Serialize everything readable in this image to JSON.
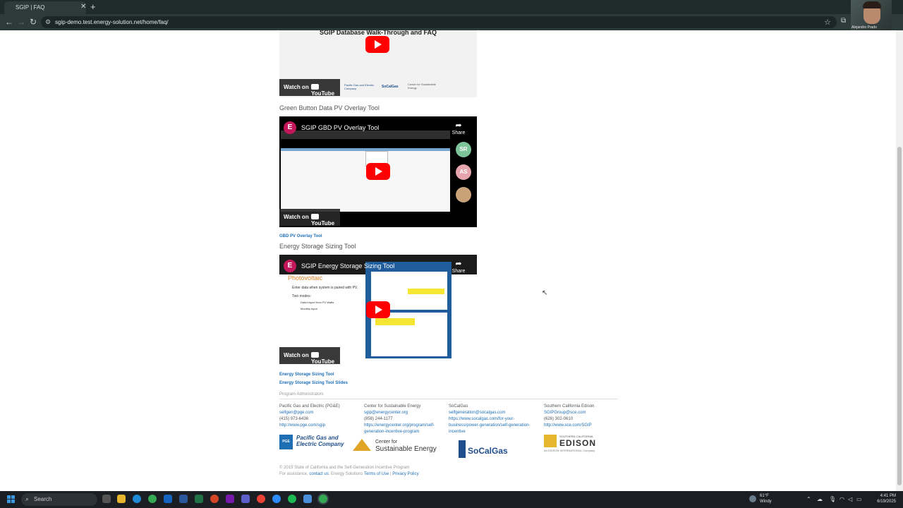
{
  "browser": {
    "tab_title": "SGIP | FAQ",
    "url": "sgip-demo.test.energy-solution.net/home/faq/",
    "webcam_label": "Alejandro Prado"
  },
  "videos": {
    "first": {
      "title": "SGIP Database Walk-Through and FAQ",
      "watch_on": "Watch on",
      "youtube": "YouTube",
      "sponsor_1": "Pacific Gas and Electric Company",
      "sponsor_2": "SoCalGas",
      "sponsor_3": "Center for Sustainable Energy"
    },
    "green_button": {
      "section_title": "Green Button Data PV Overlay Tool",
      "avatar": "E",
      "title": "SGIP GBD PV Overlay Tool",
      "share": "Share",
      "watch_on": "Watch on",
      "youtube": "YouTube",
      "participant_1": "SR",
      "participant_2": "AS",
      "link": "GBD PV Overlay Tool"
    },
    "storage": {
      "section_title": "Energy Storage Sizing Tool",
      "avatar": "E",
      "title": "SGIP Energy Storage Sizing Tool",
      "share": "Share",
      "watch_on": "Watch on",
      "youtube": "YouTube",
      "slide_heading": "Photovoltaic",
      "slide_bullet_1": "Enter data when system is paired with PV.",
      "slide_bullet_2": "Two modes:",
      "slide_sub_1": "Data import from PV Watts",
      "slide_sub_2": "Monthly input",
      "link_1": "Energy Storage Sizing Tool",
      "link_2": "Energy Storage Sizing Tool Slides"
    }
  },
  "admins": {
    "label": "Program Administrators",
    "pge": {
      "name": "Pacific Gas and Electric (PG&E)",
      "email": "selfgen@pge.com",
      "phone": "(415) 973-6436",
      "url": "http://www.pge.com/sgip"
    },
    "cse": {
      "name": "Center for Sustainable Energy",
      "email": "sgip@energycenter.org",
      "phone": "(858) 244-1177",
      "url_1": "https://energycenter.org/program/self-",
      "url_2": "generation-incentive-program"
    },
    "socal": {
      "name": "SoCalGas",
      "email": "selfgeneration@socalgas.com",
      "url_1": "https://www.socalgas.com/for-your-",
      "url_2": "business/power-generation/self-generation-",
      "url_3": "incentive"
    },
    "sce": {
      "name": "Southern California Edison",
      "email": "SGIPGroup@sce.com",
      "phone": "(626) 302-0610",
      "url": "http://www.sce.com/SGIP"
    }
  },
  "logos": {
    "pge_line_1": "Pacific Gas and",
    "pge_line_2": "Electric Company",
    "pge_mark": "PGE",
    "cse_line_1": "Center for",
    "cse_line_2": "Sustainable Energy",
    "socal": "SoCalGas",
    "sce_top": "SOUTHERN CALIFORNIA",
    "sce_main": "EDISON",
    "sce_sub": "An EDISON INTERNATIONAL Company"
  },
  "footer": {
    "copyright": "© 2015 State of California and the Self-Generation Incentive Program",
    "assistance_prefix": "For assistance,",
    "contact_link": "contact us",
    "energy_solutions": ". Energy Solutions",
    "terms": "Terms of Use",
    "separator": "|",
    "privacy": "Privacy Policy"
  },
  "taskbar": {
    "search_placeholder": "Search",
    "weather_temp": "61°F",
    "weather_desc": "Windy",
    "time": "4:41 PM",
    "date": "6/19/2025"
  }
}
